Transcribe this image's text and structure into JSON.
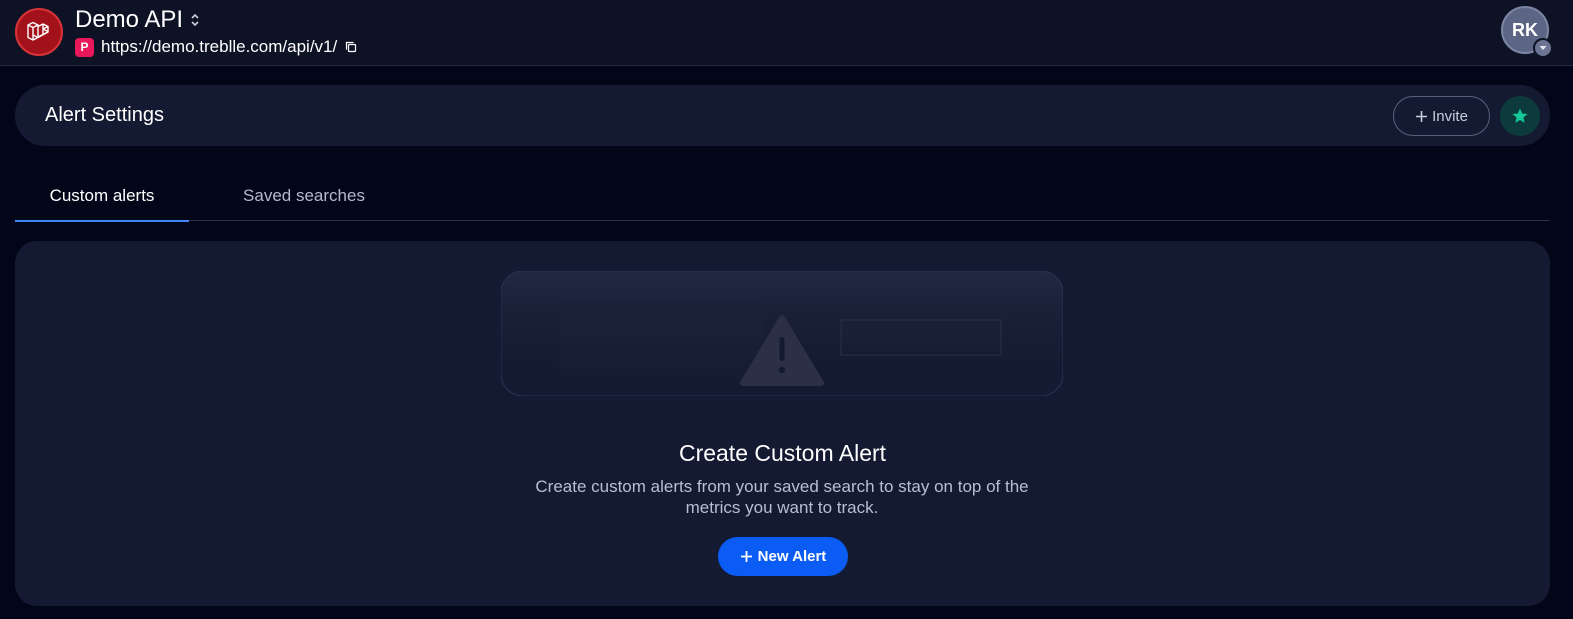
{
  "app": {
    "title": "Demo API",
    "environment_badge": "P",
    "url": "https://demo.treblle.com/api/v1/",
    "logo_icon": "laravel-logo-icon",
    "avatar_initials": "RK"
  },
  "header": {
    "page_title": "Alert Settings",
    "invite_label": "Invite"
  },
  "tabs": [
    {
      "label": "Custom alerts",
      "active": true
    },
    {
      "label": "Saved searches",
      "active": false
    }
  ],
  "empty_state": {
    "illustration_icon": "warning-triangle-icon",
    "title": "Create Custom Alert",
    "description": "Create custom alerts from your saved search to stay on top of the metrics you want to track.",
    "button_label": "New Alert"
  },
  "colors": {
    "background": "#030619",
    "card": "#141a31",
    "accent_blue": "#0b5cf5",
    "tab_underline": "#3f83f8",
    "logo_red": "#a3121a",
    "env_badge_pink": "#e8185a",
    "star_teal": "#16c79a"
  }
}
